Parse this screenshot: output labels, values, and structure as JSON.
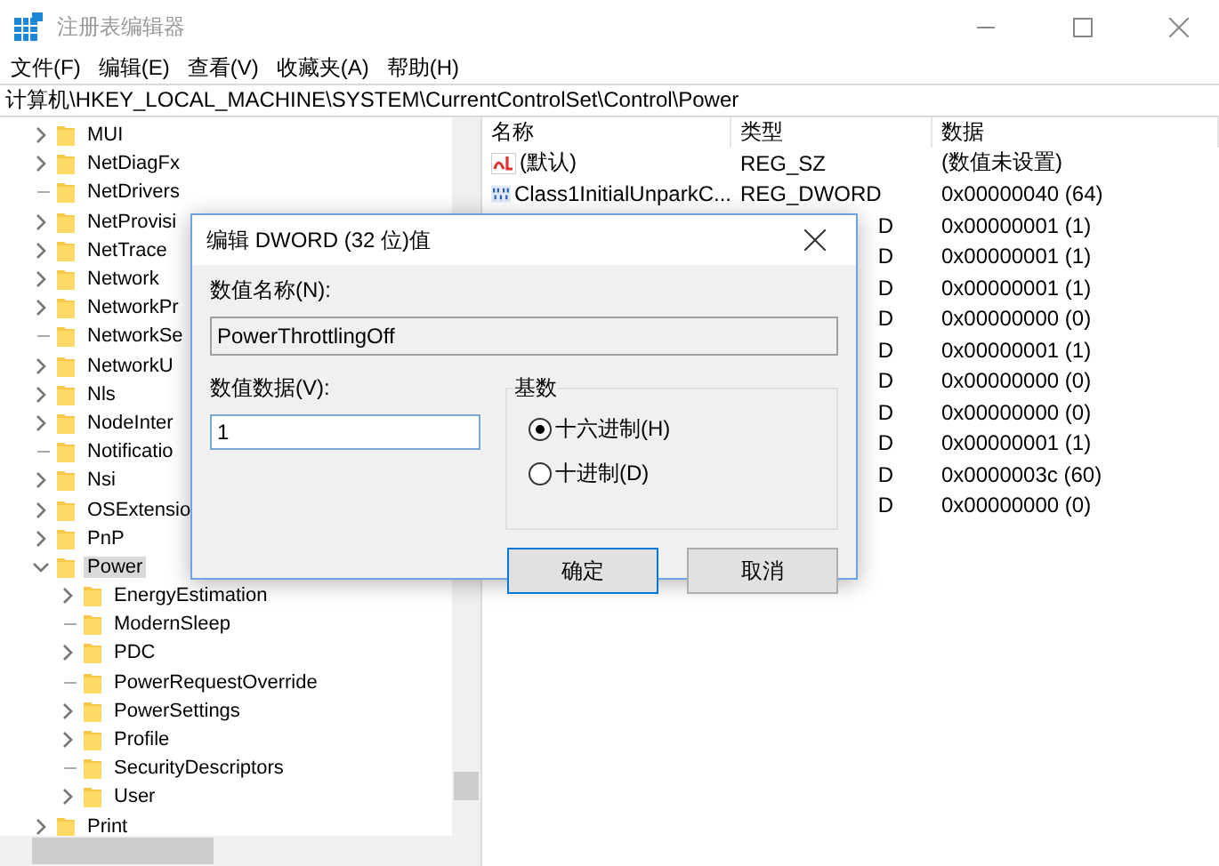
{
  "window": {
    "title": "注册表编辑器"
  },
  "menu": [
    "文件(F)",
    "编辑(E)",
    "查看(V)",
    "收藏夹(A)",
    "帮助(H)"
  ],
  "address": "计算机\\HKEY_LOCAL_MACHINE\\SYSTEM\\CurrentControlSet\\Control\\Power",
  "tree": [
    {
      "label": "MUI",
      "kind": "branch",
      "expanded": false,
      "selected": false
    },
    {
      "label": "NetDiagFx",
      "kind": "branch",
      "expanded": false,
      "selected": false
    },
    {
      "label": "NetDrivers",
      "kind": "leaf",
      "selected": false
    },
    {
      "label": "NetProvisi",
      "kind": "branch",
      "expanded": false,
      "selected": false
    },
    {
      "label": "NetTrace",
      "kind": "branch",
      "expanded": false,
      "selected": false
    },
    {
      "label": "Network",
      "kind": "branch",
      "expanded": false,
      "selected": false
    },
    {
      "label": "NetworkPr",
      "kind": "branch",
      "expanded": false,
      "selected": false
    },
    {
      "label": "NetworkSe",
      "kind": "leaf",
      "selected": false
    },
    {
      "label": "NetworkU",
      "kind": "branch",
      "expanded": false,
      "selected": false
    },
    {
      "label": "Nls",
      "kind": "branch",
      "expanded": false,
      "selected": false
    },
    {
      "label": "NodeInter",
      "kind": "branch",
      "expanded": false,
      "selected": false
    },
    {
      "label": "Notificatio",
      "kind": "leaf",
      "selected": false
    },
    {
      "label": "Nsi",
      "kind": "branch",
      "expanded": false,
      "selected": false
    },
    {
      "label": "OSExtensio",
      "kind": "branch",
      "expanded": false,
      "selected": false
    },
    {
      "label": "PnP",
      "kind": "branch",
      "expanded": false,
      "selected": false
    },
    {
      "label": "Power",
      "kind": "branch",
      "expanded": true,
      "selected": true,
      "children": [
        {
          "label": "EnergyEstimation",
          "kind": "branch",
          "expanded": false,
          "selected": false
        },
        {
          "label": "ModernSleep",
          "kind": "leaf",
          "selected": false
        },
        {
          "label": "PDC",
          "kind": "branch",
          "expanded": false,
          "selected": false
        },
        {
          "label": "PowerRequestOverride",
          "kind": "leaf",
          "selected": false
        },
        {
          "label": "PowerSettings",
          "kind": "branch",
          "expanded": false,
          "selected": false
        },
        {
          "label": "Profile",
          "kind": "branch",
          "expanded": false,
          "selected": false
        },
        {
          "label": "SecurityDescriptors",
          "kind": "leaf",
          "selected": false
        },
        {
          "label": "User",
          "kind": "branch",
          "expanded": false,
          "selected": false
        }
      ]
    },
    {
      "label": "Print",
      "kind": "branch",
      "expanded": false,
      "selected": false
    }
  ],
  "values": {
    "columns": [
      "名称",
      "类型",
      "数据"
    ],
    "rows": [
      {
        "kind": "string",
        "name": "(默认)",
        "type": "REG_SZ",
        "data": "(数值未设置)"
      },
      {
        "kind": "binary",
        "name": "Class1InitialUnparkC...",
        "type": "REG_DWORD",
        "data": "0x00000040 (64)"
      },
      {
        "type": "D",
        "data": "0x00000001 (1)"
      },
      {
        "type": "D",
        "data": "0x00000001 (1)"
      },
      {
        "type": "D",
        "data": "0x00000001 (1)"
      },
      {
        "type": "D",
        "data": "0x00000000 (0)"
      },
      {
        "type": "D",
        "data": "0x00000001 (1)"
      },
      {
        "type": "D",
        "data": "0x00000000 (0)"
      },
      {
        "type": "D",
        "data": "0x00000000 (0)"
      },
      {
        "type": "D",
        "data": "0x00000001 (1)"
      },
      {
        "type": "D",
        "data": "0x0000003c (60)"
      },
      {
        "type": "D",
        "data": "0x00000000 (0)"
      }
    ]
  },
  "dialog": {
    "title": "编辑 DWORD (32 位)值",
    "name_label": "数值名称(N):",
    "name_value": "PowerThrottlingOff",
    "data_label": "数值数据(V):",
    "data_value": "1",
    "base_label": "基数",
    "bases": [
      {
        "label": "十六进制(H)",
        "selected": true
      },
      {
        "label": "十进制(D)",
        "selected": false
      }
    ],
    "buttons": [
      {
        "label": "确定",
        "default": true
      },
      {
        "label": "取消",
        "default": false
      }
    ]
  }
}
